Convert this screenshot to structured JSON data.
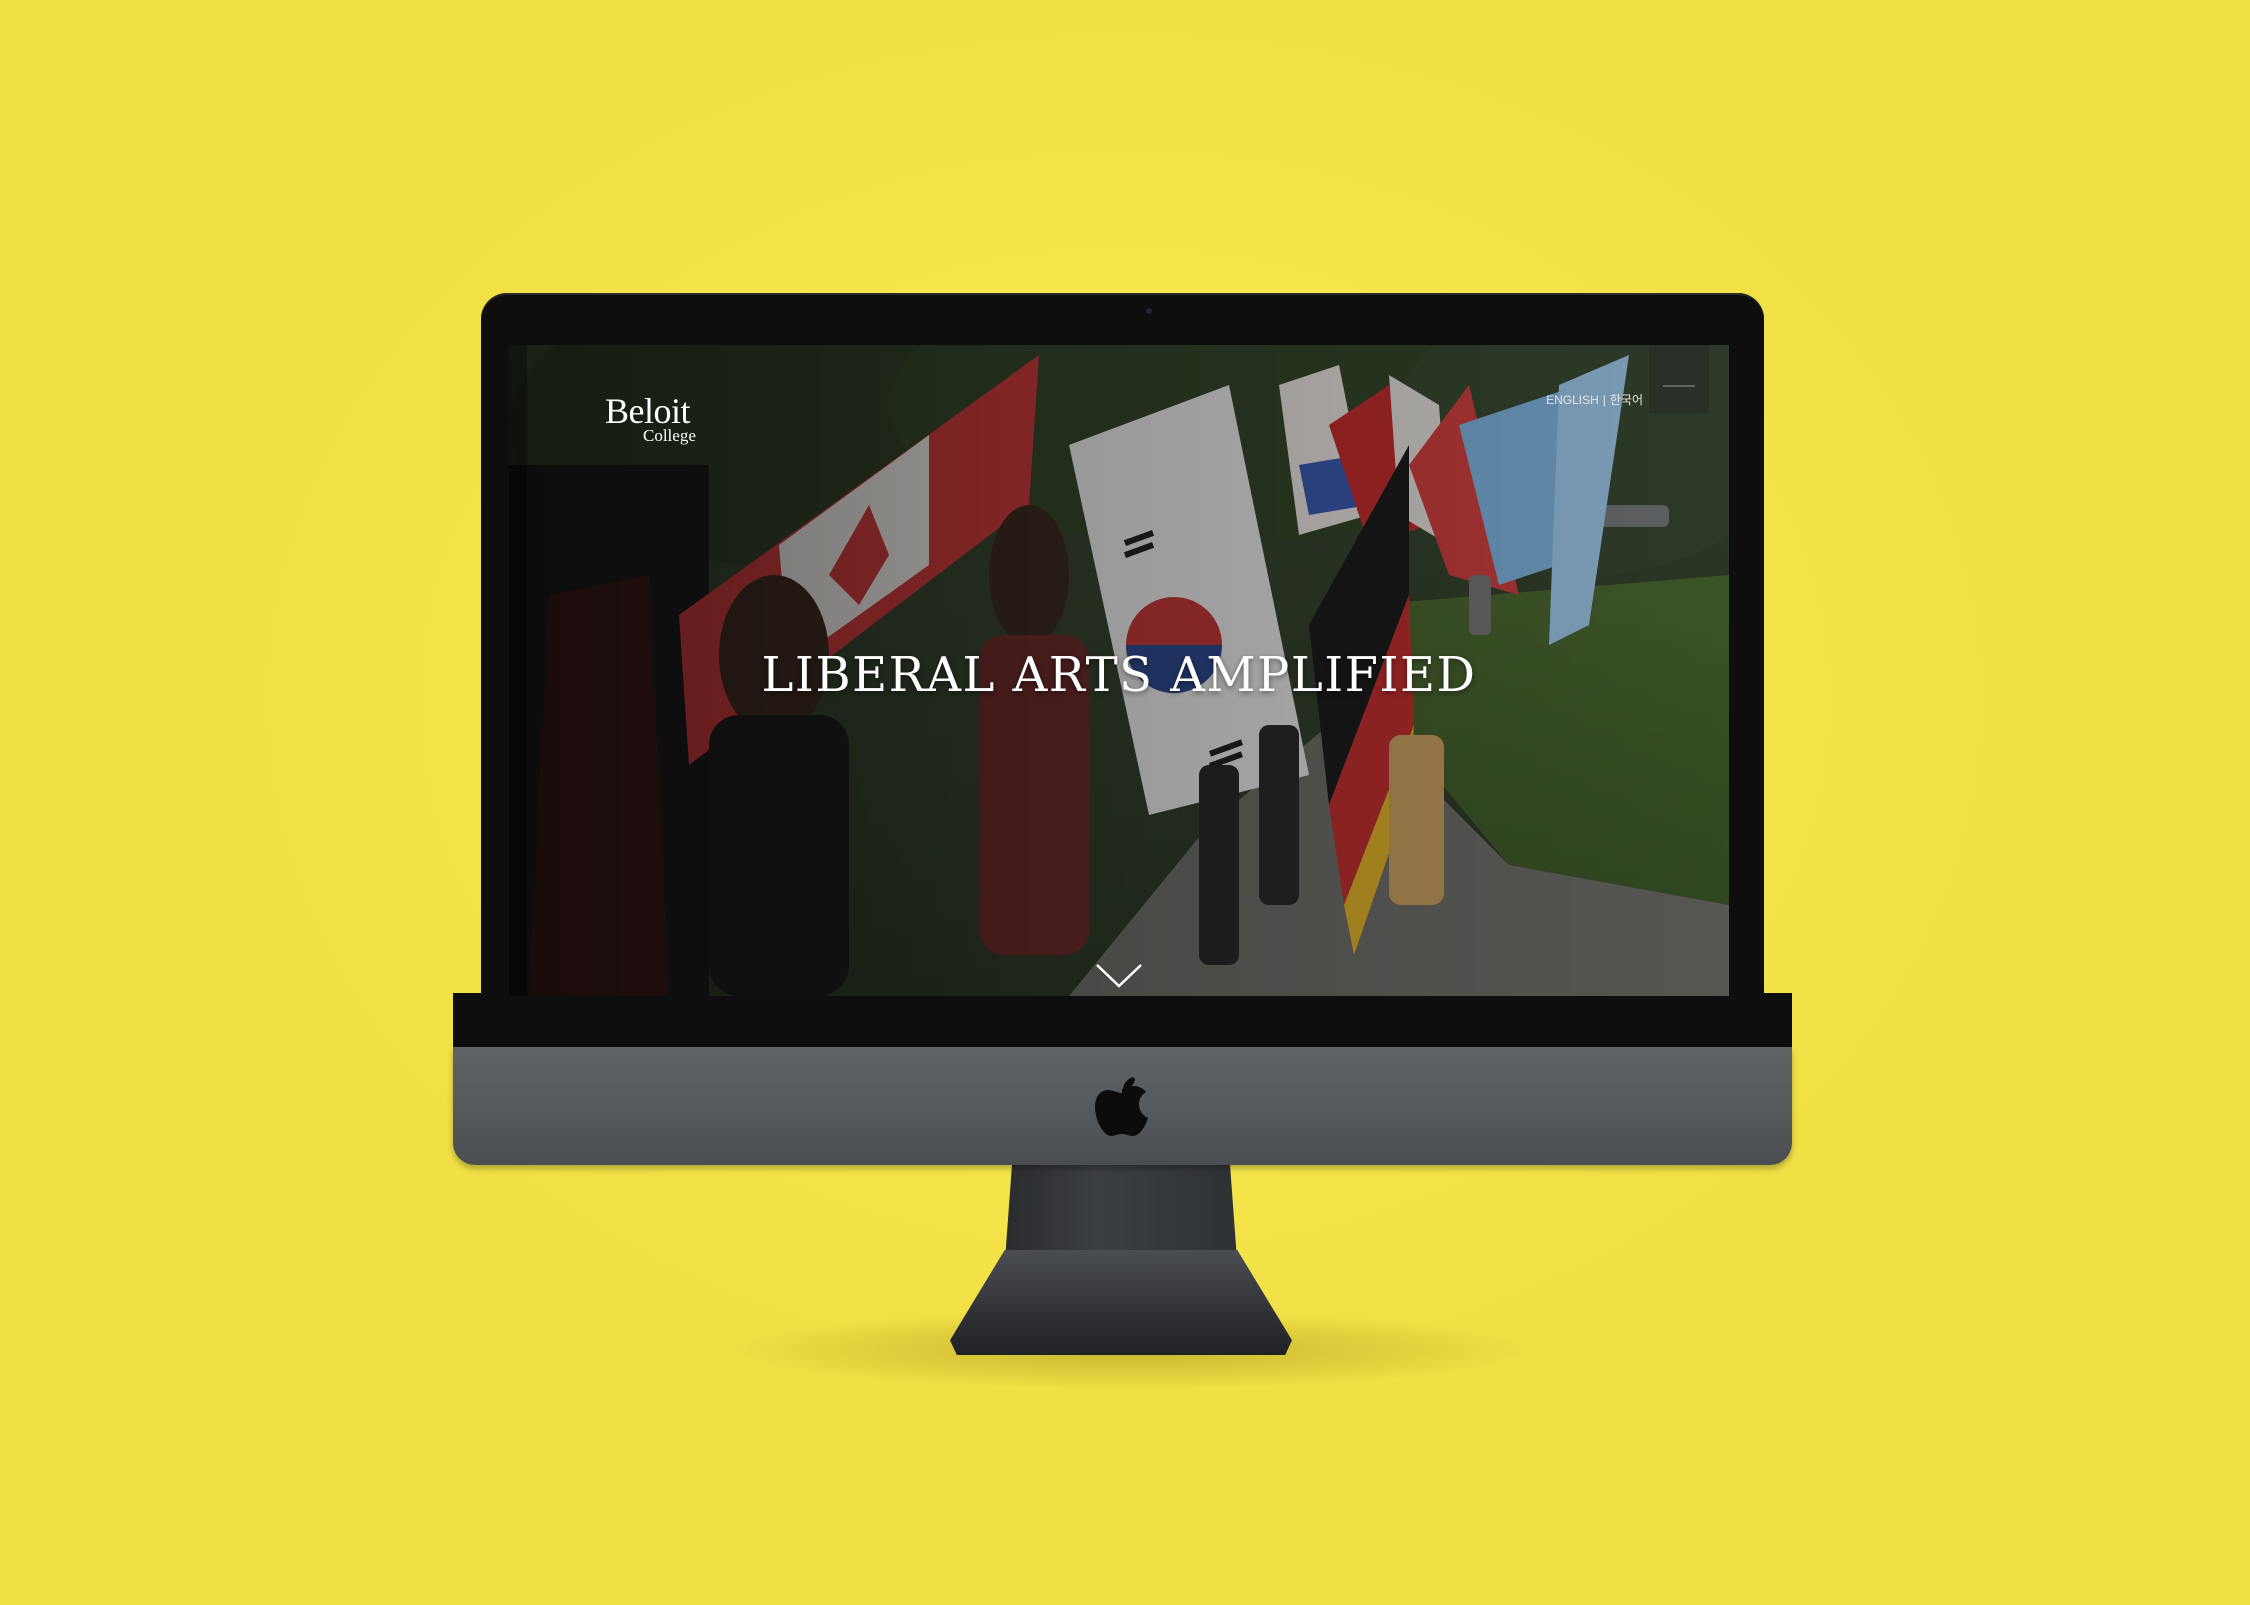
{
  "site": {
    "brand_name": "Beloit",
    "brand_sub": "College",
    "lang_english": "ENGLISH",
    "lang_separator": "|",
    "lang_korean": "한국어",
    "hero_title": "LIBERAL ARTS AMPLIFIED"
  },
  "icons": {
    "scroll": "chevron-down-icon",
    "device_logo": "apple-logo-icon"
  },
  "colors": {
    "background": "#f7e84f",
    "bezel": "#0e0e0f",
    "chin": "#5a5e61",
    "hero_text": "#ffffff"
  }
}
